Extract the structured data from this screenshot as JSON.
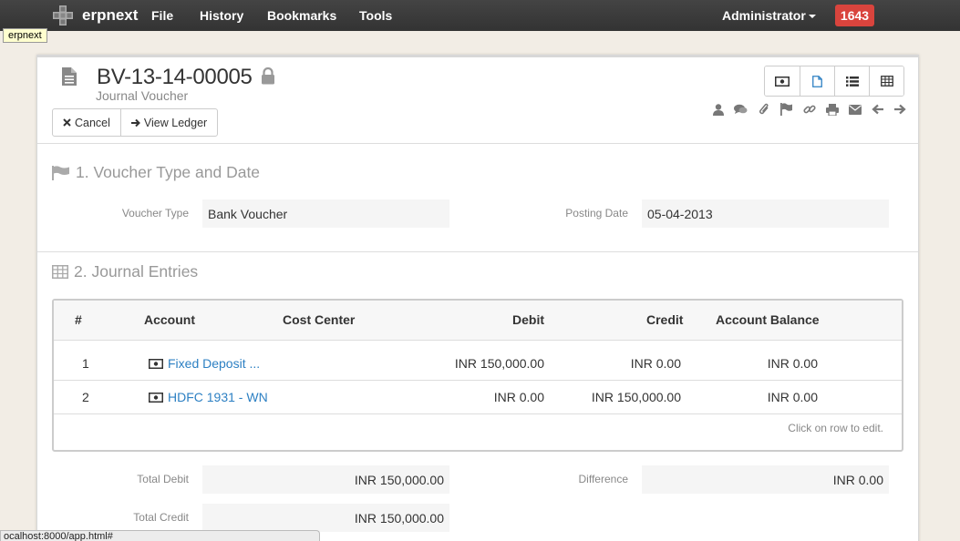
{
  "navbar": {
    "brand": "erpnext",
    "menus": [
      "File",
      "History",
      "Bookmarks",
      "Tools"
    ],
    "user": "Administrator",
    "notification_count": "1643",
    "background": "#3a3a3a"
  },
  "tooltip": "erpnext",
  "doc": {
    "title": "BV-13-14-00005",
    "subtitle": "Journal Voucher",
    "buttons": {
      "cancel": "Cancel",
      "view_ledger": "View Ledger"
    },
    "view_toggle_icons": [
      "money-icon",
      "document-icon",
      "list-icon",
      "table-icon"
    ],
    "action_icons": [
      "user-icon",
      "comments-icon",
      "paperclip-icon",
      "flag-icon",
      "link-icon",
      "print-icon",
      "envelope-icon",
      "arrow-left-icon",
      "arrow-right-icon"
    ]
  },
  "section1": {
    "heading": "1. Voucher Type and Date",
    "voucher_type_label": "Voucher Type",
    "voucher_type_value": "Bank Voucher",
    "posting_date_label": "Posting Date",
    "posting_date_value": "05-04-2013"
  },
  "section2": {
    "heading": "2. Journal Entries",
    "columns": [
      "#",
      "Account",
      "Cost Center",
      "Debit",
      "Credit",
      "Account Balance"
    ],
    "rows": [
      {
        "idx": "1",
        "account": "Fixed Deposit ...",
        "cost_center": "",
        "debit": "INR 150,000.00",
        "credit": "INR 0.00",
        "balance": "INR 0.00"
      },
      {
        "idx": "2",
        "account": "HDFC 1931 - WN",
        "cost_center": "",
        "debit": "INR 0.00",
        "credit": "INR 150,000.00",
        "balance": "INR 0.00"
      }
    ],
    "hint": "Click on row to edit."
  },
  "totals": {
    "total_debit_label": "Total Debit",
    "total_debit_value": "INR 150,000.00",
    "difference_label": "Difference",
    "difference_value": "INR 0.00",
    "total_credit_label": "Total Credit",
    "total_credit_value": "INR 150,000.00"
  },
  "status_url": "ocalhost:8000/app.html#",
  "colors": {
    "link": "#2d80c3",
    "badge": "#d9443d",
    "background": "#f2ede5"
  }
}
